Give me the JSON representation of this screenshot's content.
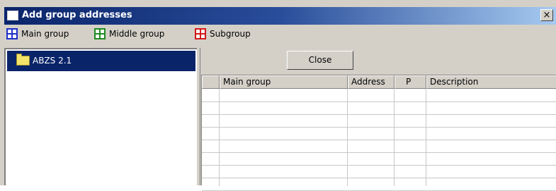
{
  "window": {
    "title": "Add group addresses",
    "close_glyph": "×"
  },
  "toolbar": {
    "items": [
      {
        "label": "Main group",
        "icon": "main-group-grid-icon",
        "color": "#1e2fc8"
      },
      {
        "label": "Middle group",
        "icon": "middle-group-grid-icon",
        "color": "#1f8a1f"
      },
      {
        "label": "Subgroup",
        "icon": "subgroup-grid-icon",
        "color": "#d01818"
      }
    ]
  },
  "tree": {
    "items": [
      {
        "label": "ABZS 2.1",
        "icon": "folder-icon",
        "selected": true
      }
    ]
  },
  "right_panel": {
    "close_button_label": "Close"
  },
  "table": {
    "columns": [
      "",
      "Main group",
      "Address",
      "P",
      "Description"
    ],
    "rows": [
      [
        "",
        "",
        "",
        "",
        ""
      ],
      [
        "",
        "",
        "",
        "",
        ""
      ],
      [
        "",
        "",
        "",
        "",
        ""
      ],
      [
        "",
        "",
        "",
        "",
        ""
      ],
      [
        "",
        "",
        "",
        "",
        ""
      ],
      [
        "",
        "",
        "",
        "",
        ""
      ],
      [
        "",
        "",
        "",
        "",
        ""
      ],
      [
        "",
        "",
        "",
        "",
        ""
      ]
    ]
  },
  "colors": {
    "titlebar_start": "#0a246a",
    "titlebar_end": "#a6caf0",
    "selection": "#0a246a",
    "face": "#d4d0c8"
  }
}
